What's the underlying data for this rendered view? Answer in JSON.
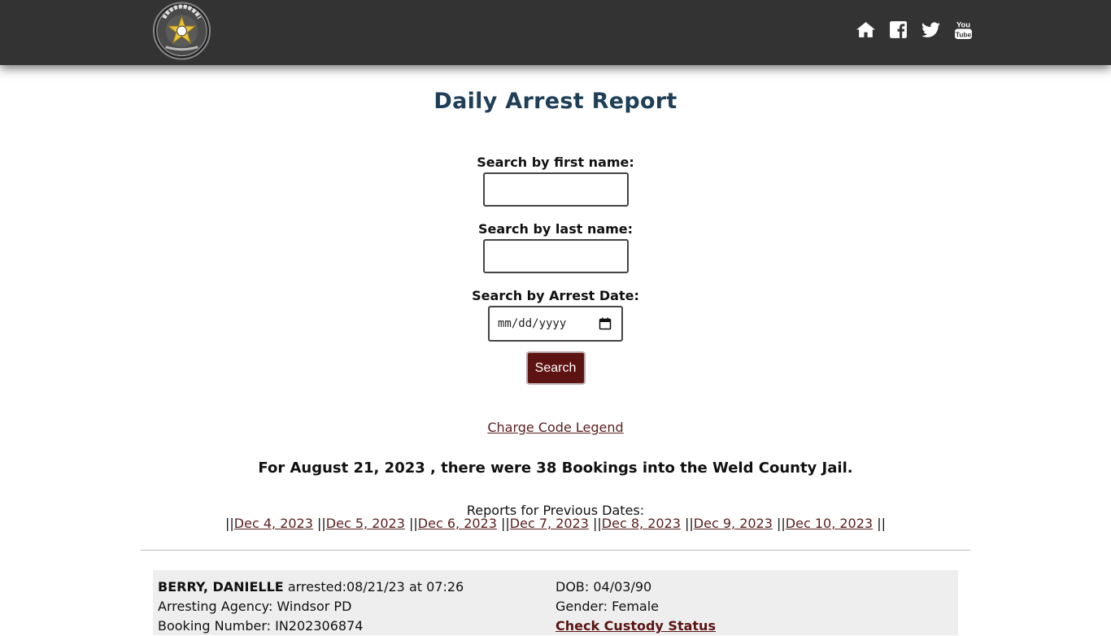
{
  "header": {
    "logo_alt": "Weld County Sheriff badge",
    "logo_text_top": "SHERIFF",
    "logo_text_bottom": "WELD COUNTY",
    "social_icons": [
      "home-icon",
      "facebook-icon",
      "twitter-icon",
      "youtube-icon"
    ]
  },
  "page": {
    "title": "Daily Arrest Report"
  },
  "search": {
    "first_name_label": "Search by first name:",
    "first_name_value": "",
    "last_name_label": "Search by last name:",
    "last_name_value": "",
    "date_label": "Search by Arrest Date:",
    "date_placeholder": "mm/dd/yyyy",
    "button_label": "Search"
  },
  "legend_link": "Charge Code Legend",
  "summary": "For August 21, 2023 , there were 38 Bookings into the Weld County Jail.",
  "previous": {
    "title": "Reports for Previous Dates:",
    "separator": "||",
    "dates": [
      "Dec 4, 2023",
      "Dec 5, 2023",
      "Dec 6, 2023",
      "Dec 7, 2023",
      "Dec 8, 2023",
      "Dec 9, 2023",
      "Dec 10, 2023"
    ]
  },
  "records": [
    {
      "name": "BERRY, DANIELLE",
      "arrested": "arrested:08/21/23 at 07:26",
      "agency": "Arresting Agency: Windsor PD",
      "booking": "Booking Number: IN202306874",
      "dob": "DOB: 04/03/90",
      "gender": "Gender: Female",
      "custody_link": "Check Custody Status"
    }
  ],
  "colors": {
    "topbar": "#333333",
    "title": "#1f3f57",
    "button": "#5e1313",
    "link": "#5b1e1e",
    "record_bg": "#eeeeee"
  }
}
